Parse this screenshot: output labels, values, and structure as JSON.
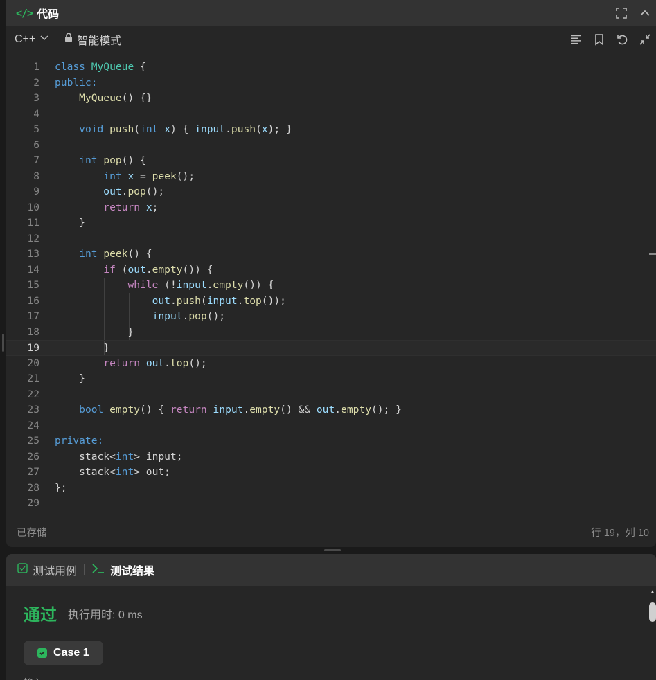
{
  "code_panel": {
    "title": "代码",
    "language": "C++",
    "mode": "智能模式",
    "status_saved": "已存储",
    "cursor_position": "行 19，列 10",
    "current_line": 19,
    "lines": [
      [
        [
          "kw",
          "class"
        ],
        [
          "pl",
          " "
        ],
        [
          "cls",
          "MyQueue"
        ],
        [
          "pl",
          " {"
        ]
      ],
      [
        [
          "kw",
          "public:"
        ]
      ],
      [
        [
          "pl",
          "    "
        ],
        [
          "fn",
          "MyQueue"
        ],
        [
          "pl",
          "() {}"
        ]
      ],
      [],
      [
        [
          "pl",
          "    "
        ],
        [
          "kw",
          "void"
        ],
        [
          "pl",
          " "
        ],
        [
          "fn",
          "push"
        ],
        [
          "pl",
          "("
        ],
        [
          "kw",
          "int"
        ],
        [
          "pl",
          " "
        ],
        [
          "var",
          "x"
        ],
        [
          "pl",
          ") { "
        ],
        [
          "var",
          "input"
        ],
        [
          "pl",
          "."
        ],
        [
          "fn",
          "push"
        ],
        [
          "pl",
          "("
        ],
        [
          "var",
          "x"
        ],
        [
          "pl",
          "); }"
        ]
      ],
      [],
      [
        [
          "pl",
          "    "
        ],
        [
          "kw",
          "int"
        ],
        [
          "pl",
          " "
        ],
        [
          "fn",
          "pop"
        ],
        [
          "pl",
          "() {"
        ]
      ],
      [
        [
          "pl",
          "        "
        ],
        [
          "kw",
          "int"
        ],
        [
          "pl",
          " "
        ],
        [
          "var",
          "x"
        ],
        [
          "pl",
          " = "
        ],
        [
          "fn",
          "peek"
        ],
        [
          "pl",
          "();"
        ]
      ],
      [
        [
          "pl",
          "        "
        ],
        [
          "var",
          "out"
        ],
        [
          "pl",
          "."
        ],
        [
          "fn",
          "pop"
        ],
        [
          "pl",
          "();"
        ]
      ],
      [
        [
          "pl",
          "        "
        ],
        [
          "ctrl",
          "return"
        ],
        [
          "pl",
          " "
        ],
        [
          "var",
          "x"
        ],
        [
          "pl",
          ";"
        ]
      ],
      [
        [
          "pl",
          "    }"
        ]
      ],
      [],
      [
        [
          "pl",
          "    "
        ],
        [
          "kw",
          "int"
        ],
        [
          "pl",
          " "
        ],
        [
          "fn",
          "peek"
        ],
        [
          "pl",
          "() {"
        ]
      ],
      [
        [
          "pl",
          "        "
        ],
        [
          "ctrl",
          "if"
        ],
        [
          "pl",
          " ("
        ],
        [
          "var",
          "out"
        ],
        [
          "pl",
          "."
        ],
        [
          "fn",
          "empty"
        ],
        [
          "pl",
          "()) {"
        ]
      ],
      [
        [
          "pl",
          "            "
        ],
        [
          "ctrl",
          "while"
        ],
        [
          "pl",
          " (!"
        ],
        [
          "var",
          "input"
        ],
        [
          "pl",
          "."
        ],
        [
          "fn",
          "empty"
        ],
        [
          "pl",
          "()) {"
        ]
      ],
      [
        [
          "pl",
          "                "
        ],
        [
          "var",
          "out"
        ],
        [
          "pl",
          "."
        ],
        [
          "fn",
          "push"
        ],
        [
          "pl",
          "("
        ],
        [
          "var",
          "input"
        ],
        [
          "pl",
          "."
        ],
        [
          "fn",
          "top"
        ],
        [
          "pl",
          "());"
        ]
      ],
      [
        [
          "pl",
          "                "
        ],
        [
          "var",
          "input"
        ],
        [
          "pl",
          "."
        ],
        [
          "fn",
          "pop"
        ],
        [
          "pl",
          "();"
        ]
      ],
      [
        [
          "pl",
          "            }"
        ]
      ],
      [
        [
          "pl",
          "        }"
        ]
      ],
      [
        [
          "pl",
          "        "
        ],
        [
          "ctrl",
          "return"
        ],
        [
          "pl",
          " "
        ],
        [
          "var",
          "out"
        ],
        [
          "pl",
          "."
        ],
        [
          "fn",
          "top"
        ],
        [
          "pl",
          "();"
        ]
      ],
      [
        [
          "pl",
          "    }"
        ]
      ],
      [],
      [
        [
          "pl",
          "    "
        ],
        [
          "kw",
          "bool"
        ],
        [
          "pl",
          " "
        ],
        [
          "fn",
          "empty"
        ],
        [
          "pl",
          "() { "
        ],
        [
          "ctrl",
          "return"
        ],
        [
          "pl",
          " "
        ],
        [
          "var",
          "input"
        ],
        [
          "pl",
          "."
        ],
        [
          "fn",
          "empty"
        ],
        [
          "pl",
          "() && "
        ],
        [
          "var",
          "out"
        ],
        [
          "pl",
          "."
        ],
        [
          "fn",
          "empty"
        ],
        [
          "pl",
          "(); }"
        ]
      ],
      [],
      [
        [
          "kw",
          "private:"
        ]
      ],
      [
        [
          "pl",
          "    stack<"
        ],
        [
          "kw",
          "int"
        ],
        [
          "pl",
          "> input;"
        ]
      ],
      [
        [
          "pl",
          "    stack<"
        ],
        [
          "kw",
          "int"
        ],
        [
          "pl",
          "> out;"
        ]
      ],
      [
        [
          "pl",
          "};"
        ]
      ],
      []
    ]
  },
  "result_panel": {
    "tabs": [
      {
        "label": "测试用例",
        "active": false
      },
      {
        "label": "测试结果",
        "active": true
      }
    ],
    "status": "通过",
    "runtime": "执行用时: 0 ms",
    "case_label": "Case 1",
    "partial_label": "输入"
  },
  "colors": {
    "accent_green": "#2db55d",
    "keyword": "#569cd6",
    "control": "#c586c0",
    "class_name": "#4ec9b0",
    "function": "#dcdcaa",
    "variable": "#9cdcfe"
  }
}
